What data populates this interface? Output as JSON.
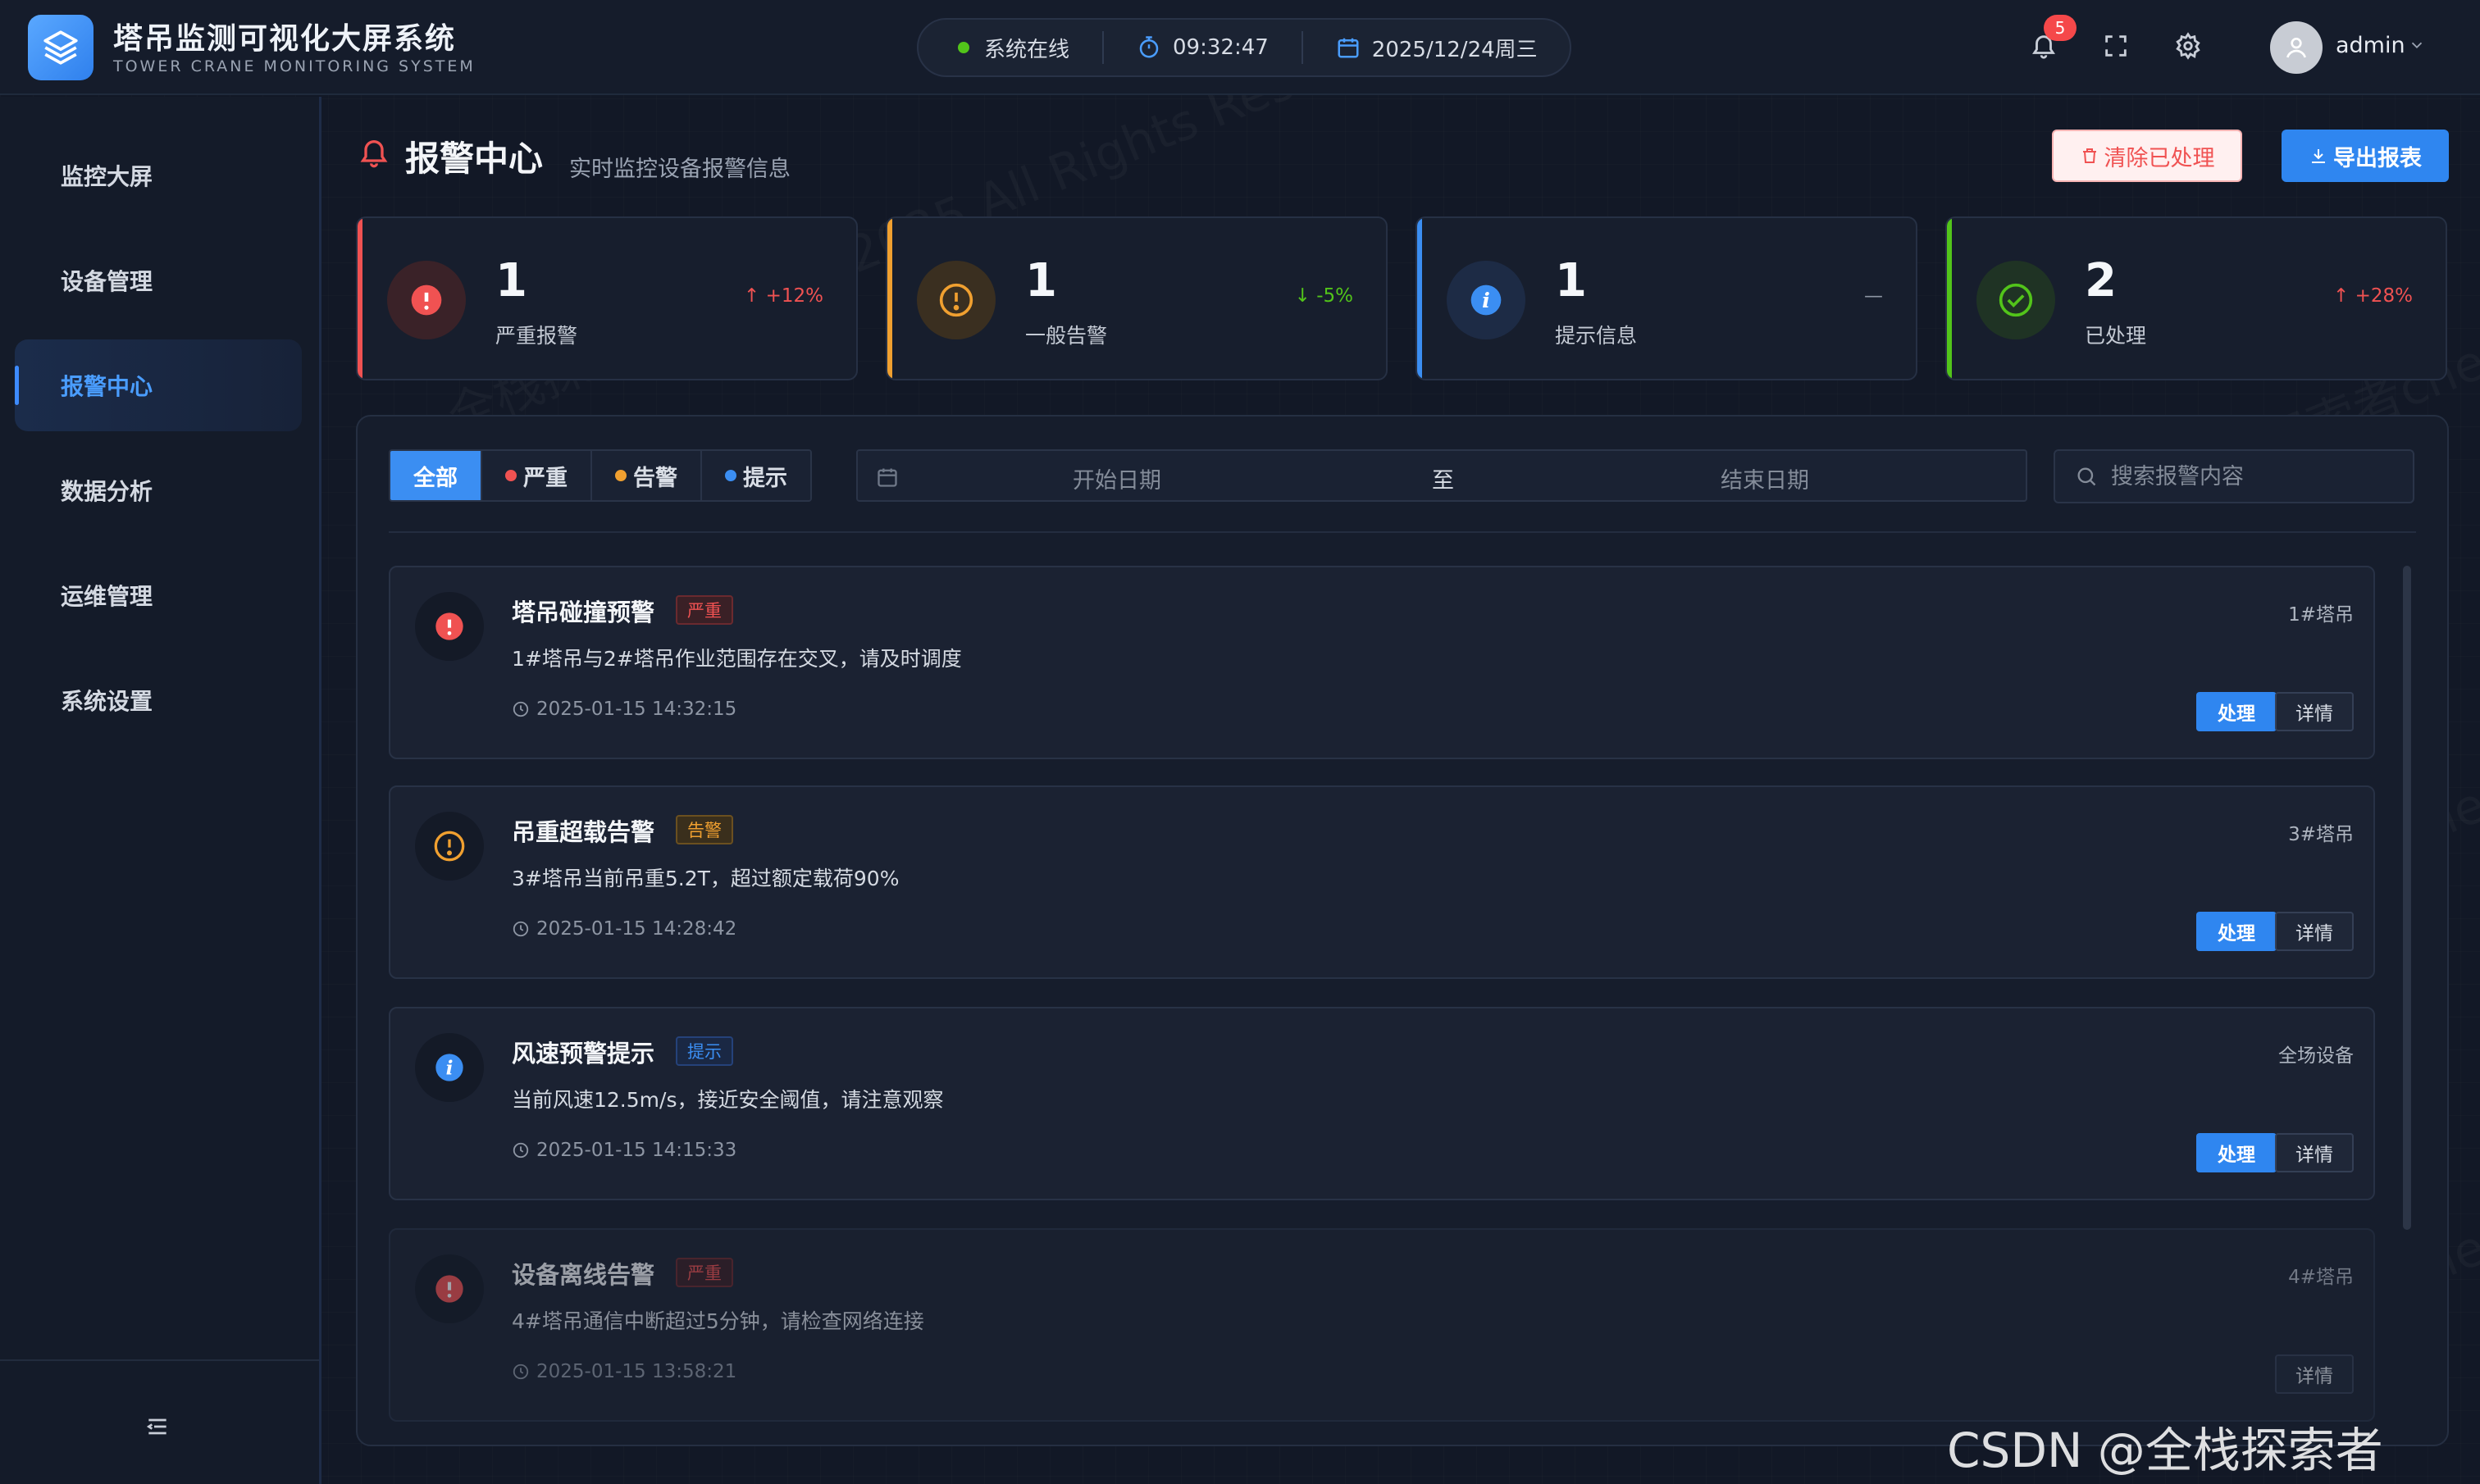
{
  "header": {
    "title": "塔吊监测可视化大屏系统",
    "subtitle": "TOWER CRANE MONITORING SYSTEM",
    "status": "系统在线",
    "time": "09:32:47",
    "date": "2025/12/24周三",
    "notification_count": "5",
    "username": "admin",
    "status_color": "#52c41a"
  },
  "sidebar": {
    "items": [
      {
        "label": "监控大屏"
      },
      {
        "label": "设备管理"
      },
      {
        "label": "报警中心"
      },
      {
        "label": "数据分析"
      },
      {
        "label": "运维管理"
      },
      {
        "label": "系统设置"
      }
    ],
    "active_index": 2
  },
  "page": {
    "title": "报警中心",
    "subtitle": "实时监控设备报警信息",
    "clear_button": "清除已处理",
    "export_button": "导出报表"
  },
  "stats": [
    {
      "value": "1",
      "label": "严重报警",
      "trend": "+12%",
      "trend_dir": "up",
      "color": "#f05252",
      "icon": "exclamation-circle-icon"
    },
    {
      "value": "1",
      "label": "一般告警",
      "trend": "-5%",
      "trend_dir": "down",
      "color": "#f0a030",
      "icon": "warning-circle-icon"
    },
    {
      "value": "1",
      "label": "提示信息",
      "trend": "—",
      "trend_dir": "flat",
      "color": "#3b8ef2",
      "icon": "info-icon"
    },
    {
      "value": "2",
      "label": "已处理",
      "trend": "+28%",
      "trend_dir": "up",
      "color": "#52c41a",
      "icon": "check-circle-icon"
    }
  ],
  "filters": {
    "tabs": [
      {
        "label": "全部",
        "dot": ""
      },
      {
        "label": "严重",
        "dot": "#f05252"
      },
      {
        "label": "告警",
        "dot": "#f0a030"
      },
      {
        "label": "提示",
        "dot": "#3b8ef2"
      }
    ],
    "active_tab": 0,
    "start_placeholder": "开始日期",
    "range_separator": "至",
    "end_placeholder": "结束日期",
    "search_placeholder": "搜索报警内容"
  },
  "alarms": [
    {
      "title": "塔吊碰撞预警",
      "level": "严重",
      "level_color": "#f05252",
      "description": "1#塔吊与2#塔吊作业范围存在交叉，请及时调度",
      "time": "2025-01-15 14:32:15",
      "device": "1#塔吊",
      "handle_label": "处理",
      "detail_label": "详情",
      "icon": "exclamation-circle-icon"
    },
    {
      "title": "吊重超载告警",
      "level": "告警",
      "level_color": "#f0a030",
      "description": "3#塔吊当前吊重5.2T，超过额定载荷90%",
      "time": "2025-01-15 14:28:42",
      "device": "3#塔吊",
      "handle_label": "处理",
      "detail_label": "详情",
      "icon": "warning-circle-icon"
    },
    {
      "title": "风速预警提示",
      "level": "提示",
      "level_color": "#3b8ef2",
      "description": "当前风速12.5m/s，接近安全阈值，请注意观察",
      "time": "2025-01-15 14:15:33",
      "device": "全场设备",
      "handle_label": "处理",
      "detail_label": "详情",
      "icon": "info-icon"
    },
    {
      "title": "设备离线告警",
      "level": "严重",
      "level_color": "#f05252",
      "description": "4#塔吊通信中断超过5分钟，请检查网络连接",
      "time": "2025-01-15 13:58:21",
      "device": "4#塔吊",
      "detail_label": "详情",
      "icon": "exclamation-circle-icon",
      "processed": true
    }
  ],
  "watermark": {
    "line1": "全栈探索者chen© 2025 All Rights Reserved.",
    "csdn": "CSDN @全栈探索者chen"
  }
}
